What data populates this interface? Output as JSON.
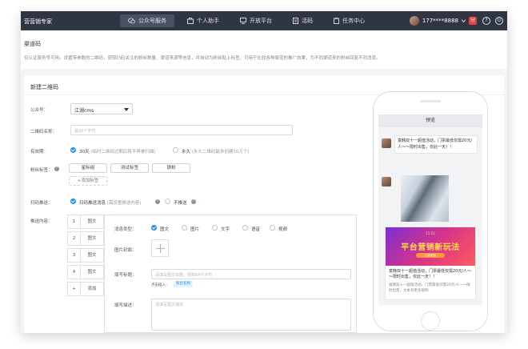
{
  "topbar": {
    "brand": "营营销专家",
    "nav": [
      {
        "label": "公众号服务",
        "icon": "wechat-icon",
        "active": true
      },
      {
        "label": "个人助手",
        "icon": "briefcase-icon",
        "active": false
      },
      {
        "label": "开放平台",
        "icon": "monitor-icon",
        "active": false
      },
      {
        "label": "活码",
        "icon": "document-icon",
        "active": false
      },
      {
        "label": "任务中心",
        "icon": "clipboard-icon",
        "active": false
      }
    ],
    "phone": "177****8888",
    "badge": "分",
    "icons": [
      "help-icon",
      "power-icon"
    ]
  },
  "intro": {
    "title": "渠道码",
    "desc": "仅认证服务号可用。设置带参数的二维码，获取扫码关注的粉丝数量、渠道来源等信息，并自动为粉丝贴上标签，可用于比较各种渠道的推广效果，为不同渠道来的粉丝回复不同消息。"
  },
  "form": {
    "section_title": "新建二维码",
    "account_label": "公众号：",
    "account_value": "江湖cms",
    "name_label": "二维码名称：",
    "name_placeholder": "最20个字符",
    "validity_label": "有效期：",
    "validity_options": [
      {
        "label": "30天",
        "note": "(临时二维码过期后将不再被扫描)",
        "selected": true
      },
      {
        "label": "永久",
        "note": "(永久二维码最多创建10万个)",
        "selected": false
      }
    ],
    "tag_label": "粉丝标签：",
    "tags": [
      "星标组",
      "测试标签",
      "铁粉"
    ],
    "add_tag": "+添加标签",
    "push_label": "扫码推送：",
    "push_options": [
      {
        "label": "扫码推送消息",
        "note": "(需设置推送内容)",
        "selected": true
      },
      {
        "label": "不推送",
        "note": "",
        "selected": false
      }
    ],
    "content_label": "推送内容：",
    "messages": [
      {
        "num": "1",
        "label": "图文"
      },
      {
        "num": "2",
        "label": "图文"
      },
      {
        "num": "3",
        "label": "图文"
      },
      {
        "num": "4",
        "label": "图文"
      },
      {
        "num": "+",
        "label": "添加"
      }
    ],
    "msg_type_label": "消息类型：",
    "msg_types": [
      {
        "label": "图文",
        "selected": true
      },
      {
        "label": "图片",
        "selected": false
      },
      {
        "label": "文字",
        "selected": false
      },
      {
        "label": "语音",
        "selected": false
      },
      {
        "label": "视频",
        "selected": false
      }
    ],
    "cover_label": "图片封面：",
    "title_label": "填写标题：",
    "title_placeholder": "请填写图文标题，限制64个字符",
    "insert_label": "点击插入：",
    "insert_chip": "粉丝名称",
    "desc_label": "填写描述：",
    "desc_placeholder": "请填写图文描述"
  },
  "preview": {
    "title": "预览",
    "bubble_text": "富韩双十一超值活动，门票最低仅需20元/人～～限时出售，仅此一天！！",
    "banner_small": "11.11",
    "banner_title": "平台营销新玩法",
    "banner_sub": "立即参加",
    "card_title": "富韩双十一超值活动，门票最低仅需20元/人～～限时出售，仅此一天！！",
    "card_desc": "富韩双十一超值活动，门票最低仅需20元/人～～限时出售，文本有更多限制"
  }
}
